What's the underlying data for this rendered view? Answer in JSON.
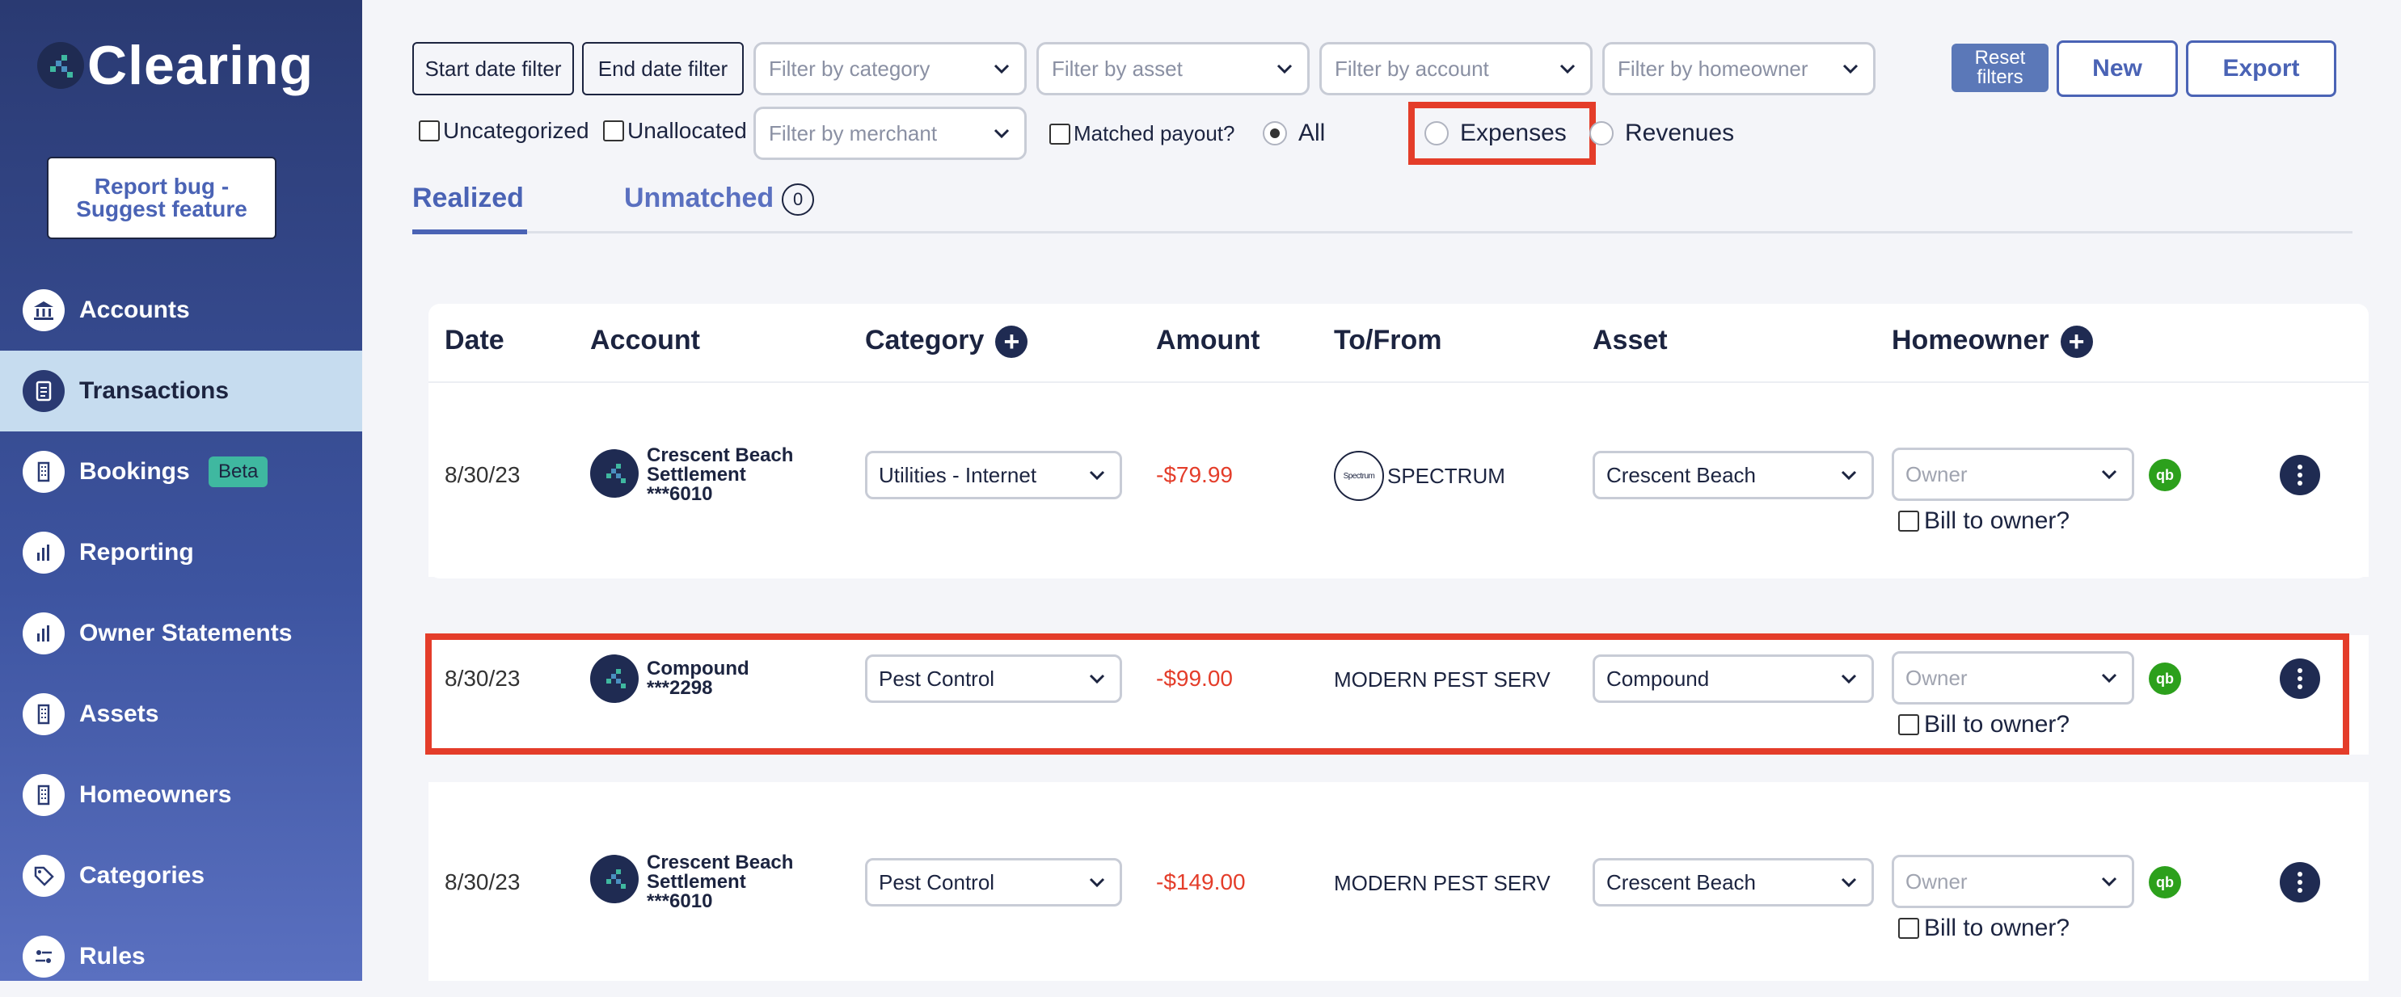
{
  "app": {
    "logo_text": "Clearing",
    "report_bug_label": "Report bug - Suggest feature"
  },
  "sidebar": {
    "items": [
      {
        "label": "Accounts",
        "icon": "bank-icon"
      },
      {
        "label": "Transactions",
        "icon": "document-icon",
        "active": true
      },
      {
        "label": "Bookings",
        "icon": "building-icon",
        "badge": "Beta"
      },
      {
        "label": "Reporting",
        "icon": "bar-chart-icon"
      },
      {
        "label": "Owner Statements",
        "icon": "bar-chart-icon"
      },
      {
        "label": "Assets",
        "icon": "building-icon"
      },
      {
        "label": "Homeowners",
        "icon": "building-icon"
      },
      {
        "label": "Categories",
        "icon": "tag-icon"
      },
      {
        "label": "Rules",
        "icon": "rules-icon"
      }
    ]
  },
  "filters": {
    "start_date": "Start date filter",
    "end_date": "End date filter",
    "category": "Filter by category",
    "asset": "Filter by asset",
    "account": "Filter by account",
    "homeowner": "Filter by homeowner",
    "merchant": "Filter by merchant",
    "uncategorized": "Uncategorized",
    "unallocated": "Unallocated",
    "matched_payout": "Matched payout?",
    "radio_all": "All",
    "radio_expenses": "Expenses",
    "radio_revenues": "Revenues",
    "selected_radio": "All"
  },
  "toolbar": {
    "reset": "Reset filters",
    "new": "New",
    "export": "Export"
  },
  "tabs": {
    "realized": "Realized",
    "unmatched": "Unmatched",
    "unmatched_count": "0"
  },
  "table": {
    "headers": {
      "date": "Date",
      "account": "Account",
      "category": "Category",
      "amount": "Amount",
      "to_from": "To/From",
      "asset": "Asset",
      "homeowner": "Homeowner"
    },
    "owner_placeholder": "Owner",
    "bill_label": "Bill to owner?",
    "qb_label": "qb",
    "rows": [
      {
        "date": "8/30/23",
        "account_line1": "Crescent Beach",
        "account_line2": "Settlement",
        "account_line3": "***6010",
        "category": "Utilities - Internet",
        "amount": "-$79.99",
        "to_from": "SPECTRUM",
        "to_from_logo": "Spectrum",
        "asset": "Crescent Beach"
      },
      {
        "date": "8/30/23",
        "account_line1": "Compound",
        "account_line2": "***2298",
        "category": "Pest Control",
        "amount": "-$99.00",
        "to_from": "MODERN PEST SERV",
        "asset": "Compound"
      },
      {
        "date": "8/30/23",
        "account_line1": "Crescent Beach",
        "account_line2": "Settlement",
        "account_line3": "***6010",
        "category": "Pest Control",
        "amount": "-$149.00",
        "to_from": "MODERN PEST SERV",
        "asset": "Crescent Beach"
      }
    ]
  },
  "colors": {
    "highlight": "#e43d2a",
    "accent": "#4a63b5",
    "amount_negative": "#e43d2a",
    "sidebar_active": "#c6dcef"
  }
}
